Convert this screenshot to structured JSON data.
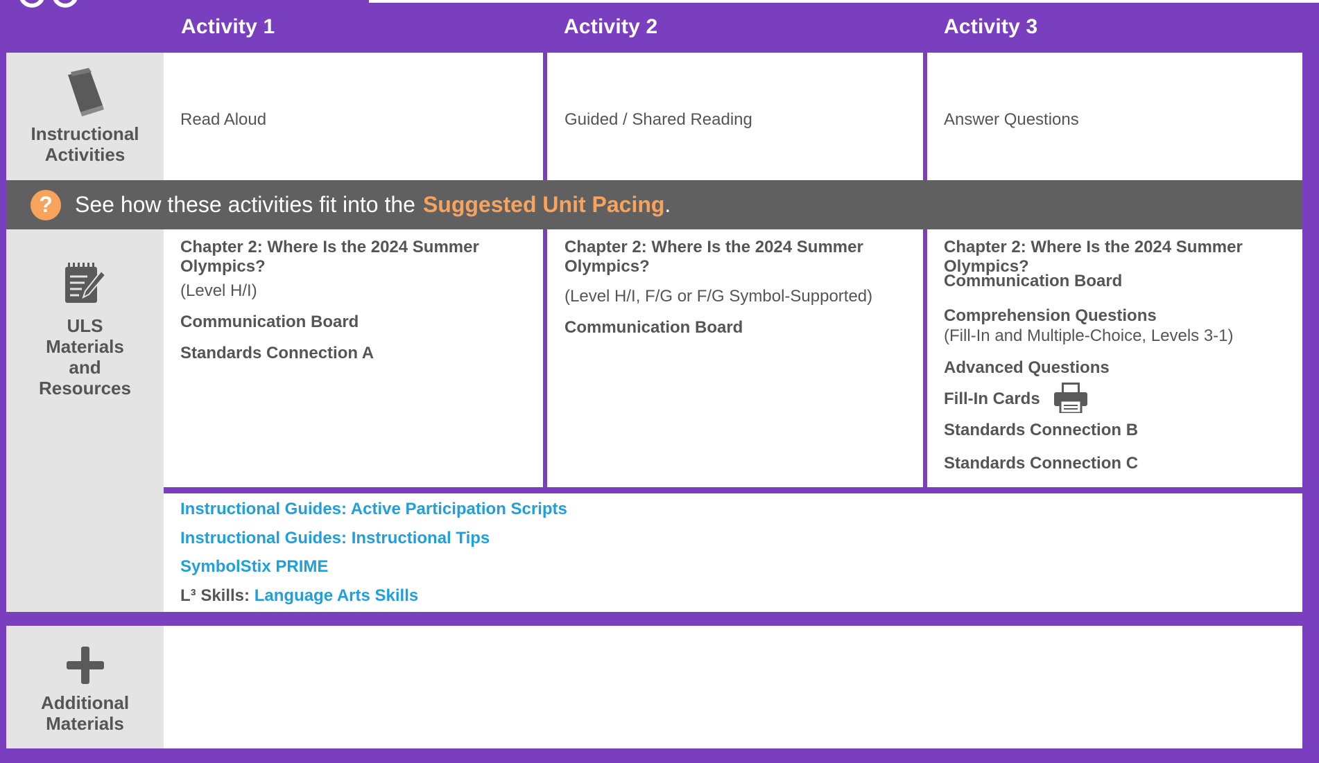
{
  "header": {
    "activities": [
      "Activity 1",
      "Activity 2",
      "Activity 3"
    ]
  },
  "instructional": {
    "label_line1": "Instructional",
    "label_line2": "Activities",
    "icon": "book-icon",
    "activities": [
      "Read Aloud",
      "Guided / Shared Reading",
      "Answer Questions"
    ]
  },
  "pacing": {
    "prefix": "See how these activities fit into the",
    "link": "Suggested Unit Pacing",
    "suffix": "."
  },
  "uls": {
    "label_lines": [
      "ULS",
      "Materials",
      "and",
      "Resources"
    ],
    "icon": "notepad-icon",
    "col1": {
      "chapter_line1": "Chapter 2: Where Is the 2024 Summer",
      "chapter_line2": "Olympics?",
      "level": "(Level H/I)",
      "items": [
        "Communication Board",
        "Standards Connection A"
      ]
    },
    "col2": {
      "chapter_line1": "Chapter 2: Where Is the 2024 Summer",
      "chapter_line2": "Olympics?",
      "level": "(Level H/I, F/G or F/G Symbol-Supported)",
      "items": [
        "Communication Board"
      ]
    },
    "col3": {
      "chapter_line1": "Chapter 2: Where Is the 2024 Summer",
      "chapter_line2": "Olympics?",
      "communication": "Communication Board",
      "comprehension": "Comprehension Questions",
      "comprehension_sub": "(Fill-In and Multiple-Choice, Levels 3-1)",
      "advanced": "Advanced Questions",
      "fill_in": "Fill-In Cards",
      "std_b": "Standards Connection B",
      "std_c": "Standards Connection C"
    },
    "guides": {
      "link1": "Instructional Guides: Active Participation Scripts",
      "link2": "Instructional Guides: Instructional Tips",
      "link3": "SymbolStix PRIME",
      "l3_label": "L³ Skills:",
      "l3_link": "Language Arts Skills"
    }
  },
  "additional": {
    "label_line1": "Additional",
    "label_line2": "Materials",
    "icon": "plus-icon"
  },
  "colors": {
    "brand_purple": "#7a3fbe",
    "link_blue": "#1fa0dc",
    "accent_orange": "#f7a35c",
    "bar_gray": "#606060"
  }
}
